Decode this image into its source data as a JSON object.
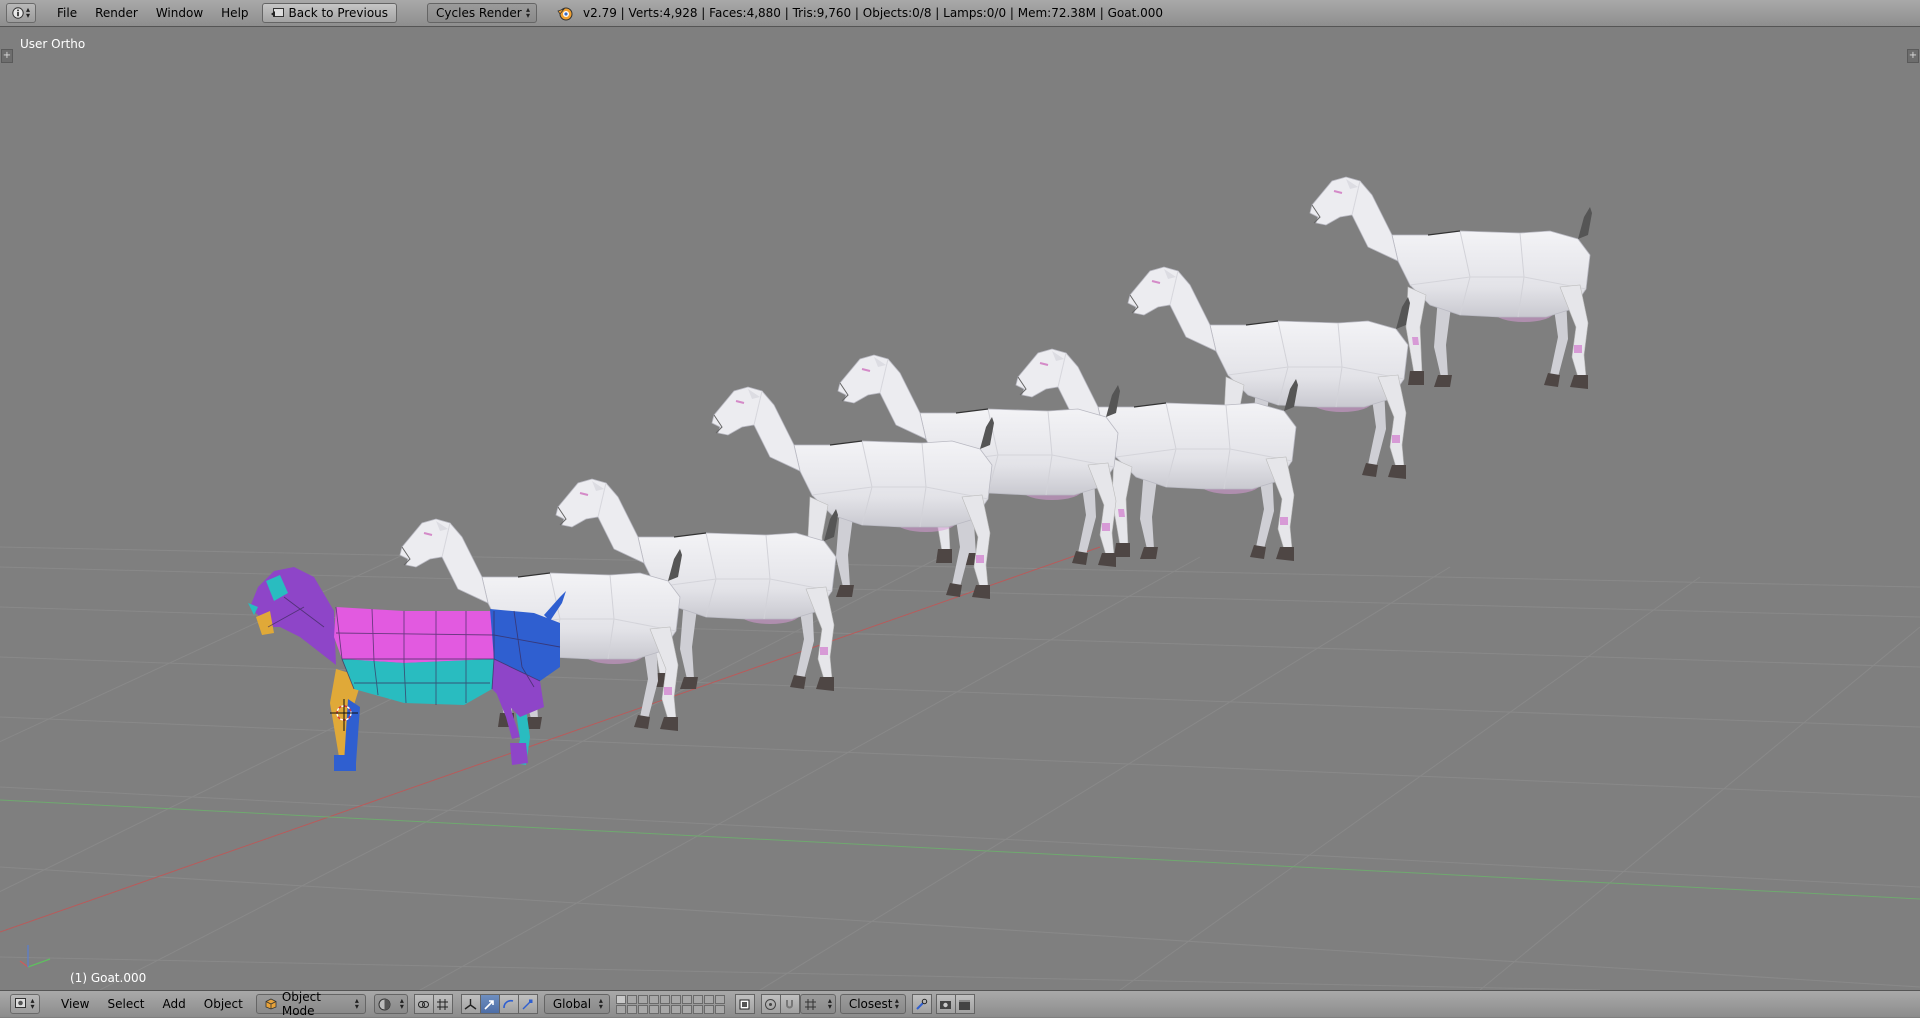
{
  "app": {
    "name": "Blender",
    "version": "v2.79"
  },
  "top_bar": {
    "menus": [
      "File",
      "Render",
      "Window",
      "Help"
    ],
    "back_button": "Back to Previous",
    "render_engine": "Cycles Render",
    "stats": "v2.79 | Verts:4,928 | Faces:4,880 | Tris:9,760 | Objects:0/8 | Lamps:0/0 | Mem:72.38M | Goat.000"
  },
  "viewport": {
    "view_label": "User Ortho",
    "object_label": "(1) Goat.000",
    "background": "#7f7f7f",
    "grid_color": "#8a8a8a",
    "x_axis_color": "#b85b5b",
    "y_axis_color": "#6fa96f"
  },
  "bottom_bar": {
    "menus": [
      "View",
      "Select",
      "Add",
      "Object"
    ],
    "mode": "Object Mode",
    "orientation": "Global",
    "snap_target": "Closest"
  },
  "colors": {
    "header_bg": "#9a9a9a",
    "accent": "#5680c2",
    "goat_white": "#e6e6ea",
    "goat_hoof": "#4e4644",
    "goat_pink": "#d79ad6",
    "uv_magenta": "#e25ae0",
    "uv_cyan": "#29bcc0",
    "uv_blue": "#2f5fd0",
    "uv_purple": "#8e45c8",
    "uv_yellow": "#e0a938"
  }
}
